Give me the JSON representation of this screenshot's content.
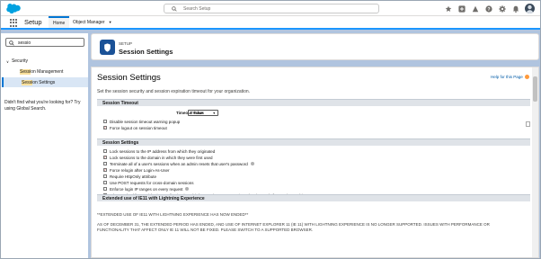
{
  "header": {
    "search_placeholder": "Search Setup"
  },
  "context": {
    "app_name": "Setup",
    "tab_home": "Home",
    "tab_object_manager": "Object Manager"
  },
  "sidebar": {
    "quickfind_value": "sessio",
    "group": "Security",
    "items": [
      {
        "pre": "",
        "hl": "Sessi",
        "post": "on Management"
      },
      {
        "pre": "",
        "hl": "Sessi",
        "post": "on Settings"
      }
    ],
    "help_text": "Didn't find what you're looking for? Try using Global Search."
  },
  "page_header": {
    "breadcrumb": "SETUP",
    "title": "Session Settings"
  },
  "content": {
    "title": "Session Settings",
    "help_link": "Help for this Page",
    "description": "Set the session security and session expiration timeout for your organization.",
    "section_timeout": {
      "title": "Session Timeout",
      "timeout_label": "Timeout Value",
      "timeout_value": "2 hours",
      "options": [
        {
          "label": "Disable session timeout warning popup",
          "checked": false
        },
        {
          "label": "Force logout on session timeout",
          "checked": true
        }
      ]
    },
    "section_settings": {
      "title": "Session Settings",
      "options": [
        {
          "label": "Lock sessions to the IP address from which they originated",
          "checked": false,
          "info": false
        },
        {
          "label": "Lock sessions to the domain in which they were first used",
          "checked": true,
          "info": false
        },
        {
          "label": "Terminate all of a user's sessions when an admin resets that user's password",
          "checked": false,
          "info": true
        },
        {
          "label": "Force relogin after Login-As-User",
          "checked": true,
          "info": false
        },
        {
          "label": "Require HttpOnly attribute",
          "checked": false,
          "info": false
        },
        {
          "label": "Use POST requests for cross-domain sessions",
          "checked": false,
          "info": false
        },
        {
          "label": "Enforce login IP ranges on every request",
          "checked": false,
          "info": true
        },
        {
          "label": "When embedding a Lightning application in a third-party site, use a session token instead of a session cookie.",
          "checked": false,
          "info": false
        }
      ]
    },
    "section_ie11": {
      "title": "Extended use of IE11 with Lightning Experience",
      "notice1": "**EXTENDED USE OF IE11 WITH LIGHTNING EXPERIENCE HAS NOW ENDED**",
      "notice2": "AS OF DECEMBER 31, THE EXTENDED PERIOD HAS ENDED, AND USE OF INTERNET EXPLORER 11 (IE 11) WITH LIGHTNING EXPERIENCE IS NO LONGER SUPPORTED. ISSUES WITH PERFORMANCE OR FUNCTIONALITY THAT AFFECT ONLY IE 11 WILL NOT BE FIXED. PLEASE SWITCH TO A SUPPORTED BROWSER."
    }
  },
  "colors": {
    "brand_blue": "#0176d3",
    "header_icon_bg": "#1b5297",
    "background": "#b0c4df"
  },
  "icons": [
    "salesforce-cloud-icon",
    "search-icon",
    "star-icon",
    "add-icon",
    "trailhead-icon",
    "help-icon",
    "gear-icon",
    "bell-icon",
    "waffle-icon",
    "chevron-down-icon",
    "shield-icon",
    "info-icon"
  ]
}
